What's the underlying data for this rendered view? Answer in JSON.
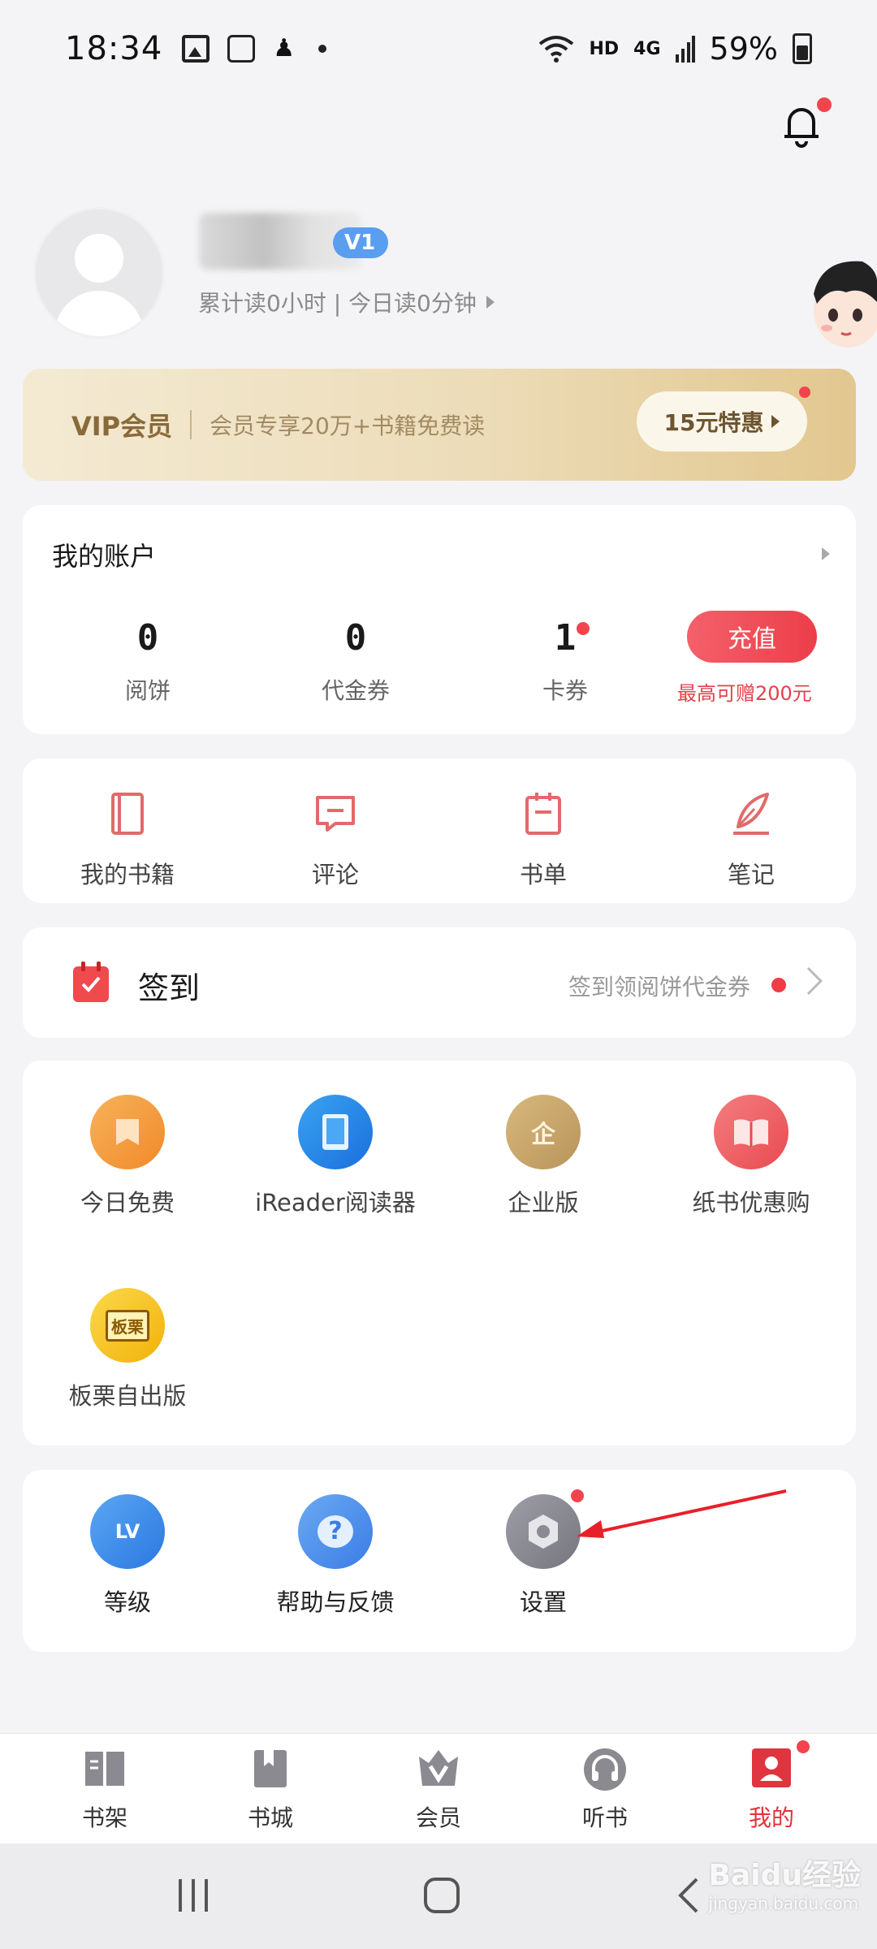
{
  "status_bar": {
    "time": "18:34",
    "network": "HD",
    "signal": "4G",
    "battery": "59%"
  },
  "profile": {
    "level": "V1",
    "read_stats": "累计读0小时 | 今日读0分钟"
  },
  "vip": {
    "title": "VIP会员",
    "desc": "会员专享20万+书籍免费读",
    "button": "15元特惠"
  },
  "account": {
    "title": "我的账户",
    "stats": [
      {
        "value": "0",
        "label": "阅饼"
      },
      {
        "value": "0",
        "label": "代金券"
      },
      {
        "value": "1",
        "label": "卡券"
      }
    ],
    "recharge_label": "充值",
    "recharge_note": "最高可赠200元"
  },
  "shortcuts": [
    {
      "label": "我的书籍",
      "icon": "book-icon"
    },
    {
      "label": "评论",
      "icon": "comment-icon"
    },
    {
      "label": "书单",
      "icon": "booklist-icon"
    },
    {
      "label": "笔记",
      "icon": "quill-icon"
    }
  ],
  "checkin": {
    "title": "签到",
    "hint": "签到领阅饼代金券"
  },
  "features": [
    {
      "label": "今日免费",
      "icon": "bookmark-icon",
      "color": "#f39a3a"
    },
    {
      "label": "iReader阅读器",
      "icon": "tablet-icon",
      "color": "#2a86e6"
    },
    {
      "label": "企业版",
      "icon": "enterprise-icon",
      "color": "#c9a56a",
      "glyph": "企"
    },
    {
      "label": "纸书优惠购",
      "icon": "open-book-icon",
      "color": "#ef5a5e"
    },
    {
      "label": "板栗自出版",
      "icon": "publish-icon",
      "color": "#f5c21a",
      "glyph": "板栗"
    }
  ],
  "tools": [
    {
      "label": "等级",
      "icon": "level-icon",
      "color": "#3d8ae8",
      "glyph": "LV"
    },
    {
      "label": "帮助与反馈",
      "icon": "help-icon",
      "color": "#4f8de8",
      "glyph": "?"
    },
    {
      "label": "设置",
      "icon": "settings-gear-icon",
      "color": "#8a8a95"
    }
  ],
  "bottom_nav": [
    {
      "label": "书架",
      "icon": "bookshelf-icon"
    },
    {
      "label": "书城",
      "icon": "bookstore-icon"
    },
    {
      "label": "会员",
      "icon": "vip-crown-icon"
    },
    {
      "label": "听书",
      "icon": "headphones-icon"
    },
    {
      "label": "我的",
      "icon": "profile-icon"
    }
  ],
  "watermark": {
    "brand": "Baidu经验",
    "url": "jingyan.baidu.com"
  }
}
